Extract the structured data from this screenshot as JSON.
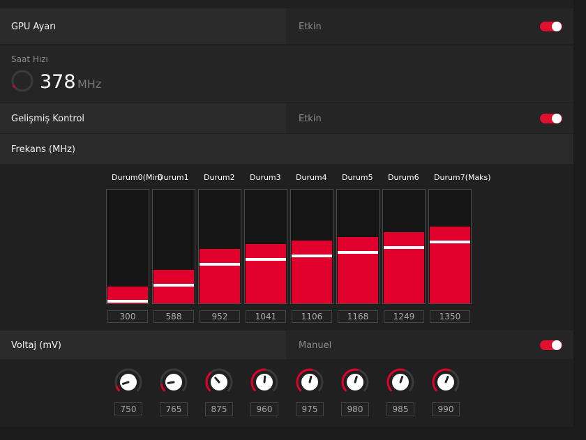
{
  "gpu": {
    "label": "GPU Ayarı",
    "status": "Etkin",
    "enabled": true
  },
  "clock": {
    "title": "Saat Hızı",
    "value": "378",
    "unit": "MHz"
  },
  "advanced": {
    "label": "Gelişmiş Kontrol",
    "status": "Etkin",
    "enabled": true
  },
  "frequency": {
    "label": "Frekans (MHz)",
    "min": 0,
    "max": 2000,
    "states": [
      {
        "name": "Durum0(Min)",
        "value": "300"
      },
      {
        "name": "Durum1",
        "value": "588"
      },
      {
        "name": "Durum2",
        "value": "952"
      },
      {
        "name": "Durum3",
        "value": "1041"
      },
      {
        "name": "Durum4",
        "value": "1106"
      },
      {
        "name": "Durum5",
        "value": "1168"
      },
      {
        "name": "Durum6",
        "value": "1249"
      },
      {
        "name": "Durum7(Maks)",
        "value": "1350"
      }
    ]
  },
  "voltage": {
    "label": "Voltaj (mV)",
    "mode": "Manuel",
    "enabled": true,
    "knob_min": 700,
    "knob_max": 1200,
    "values": [
      "750",
      "765",
      "875",
      "960",
      "975",
      "980",
      "985",
      "990"
    ]
  },
  "colors": {
    "accent": "#e0002b",
    "track": "#3a3a3a",
    "knob": "#ffffff"
  }
}
